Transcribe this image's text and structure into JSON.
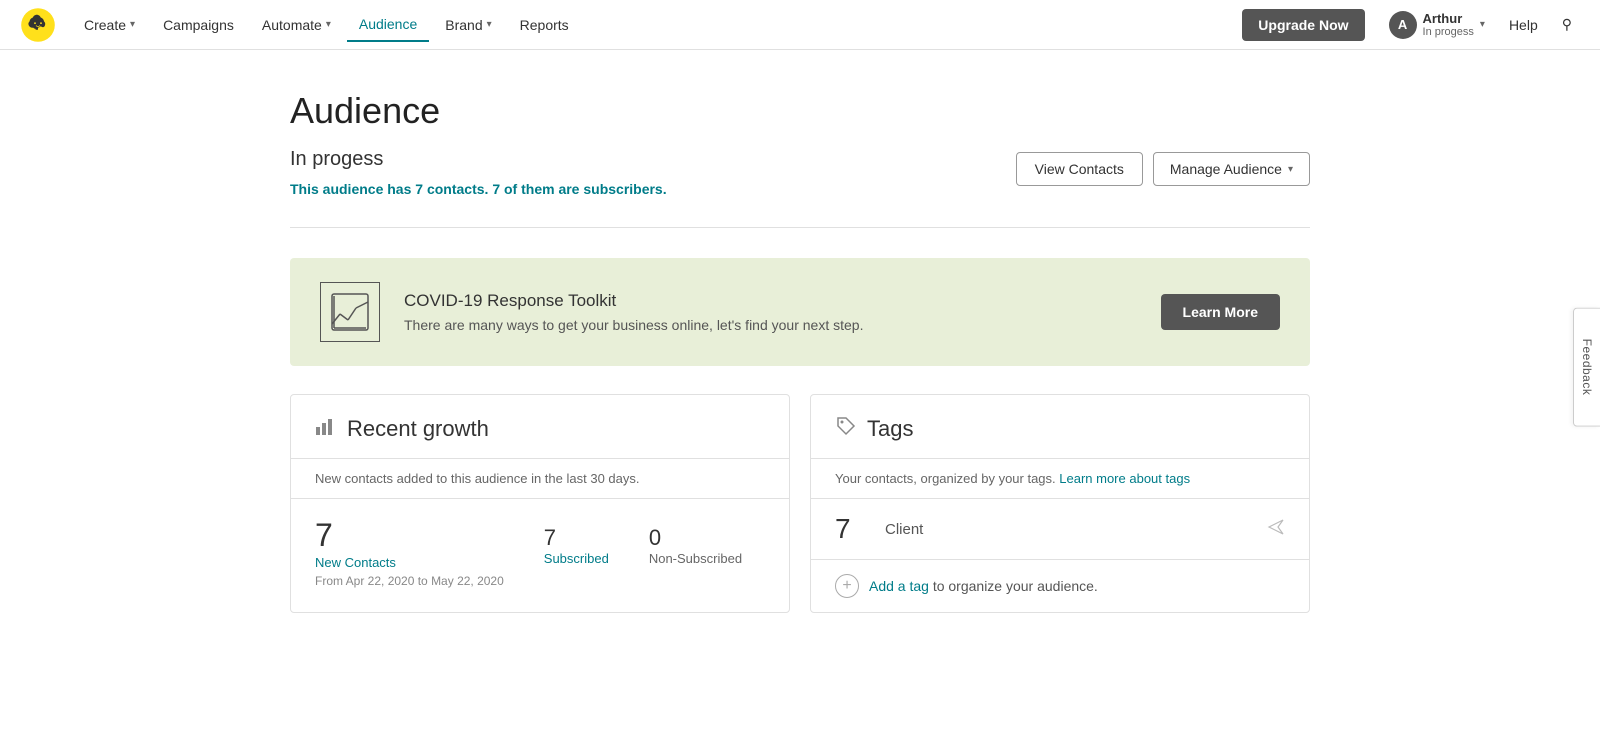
{
  "nav": {
    "logo_alt": "Mailchimp",
    "items": [
      {
        "label": "Create",
        "has_chevron": true,
        "active": false
      },
      {
        "label": "Campaigns",
        "has_chevron": false,
        "active": false
      },
      {
        "label": "Automate",
        "has_chevron": true,
        "active": false
      },
      {
        "label": "Audience",
        "has_chevron": false,
        "active": true
      },
      {
        "label": "Brand",
        "has_chevron": true,
        "active": false
      },
      {
        "label": "Reports",
        "has_chevron": false,
        "active": false
      }
    ],
    "upgrade_label": "Upgrade Now",
    "user": {
      "initial": "A",
      "name": "Arthur",
      "status": "In progess"
    },
    "help_label": "Help"
  },
  "page": {
    "title": "Audience",
    "audience_name": "In progess",
    "description_prefix": "This audience has ",
    "contacts_count": "7",
    "description_middle": " contacts. ",
    "subscribers_count": "7",
    "description_suffix": " of them are subscribers.",
    "view_contacts_label": "View Contacts",
    "manage_audience_label": "Manage Audience"
  },
  "covid_banner": {
    "title": "COVID-19 Response Toolkit",
    "subtitle": "There are many ways to get your business online, let's find your next step.",
    "cta_label": "Learn More"
  },
  "growth_card": {
    "title": "Recent growth",
    "subtitle": "New contacts added to this audience in the last 30 days.",
    "main_number": "7",
    "main_label": "New Contacts",
    "date_range": "From Apr 22, 2020 to May 22, 2020",
    "subscribed_number": "7",
    "subscribed_label": "Subscribed",
    "non_subscribed_number": "0",
    "non_subscribed_label": "Non-Subscribed"
  },
  "tags_card": {
    "title": "Tags",
    "subtitle_prefix": "Your contacts, organized by your tags. ",
    "subtitle_link": "Learn more about tags",
    "tags": [
      {
        "count": "7",
        "name": "Client"
      }
    ],
    "add_tag_prefix": "Add a tag",
    "add_tag_suffix": " to organize your audience."
  },
  "feedback": {
    "label": "Feedback"
  }
}
